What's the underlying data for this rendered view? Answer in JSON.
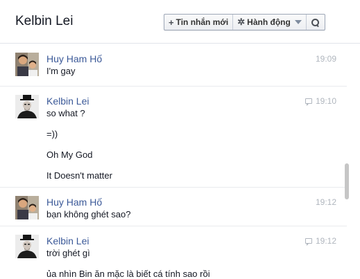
{
  "header": {
    "title": "Kelbin Lei",
    "new_message_label": "Tin nhắn mới",
    "actions_label": "Hành động"
  },
  "icons": {
    "new_message": "plus-icon",
    "actions": "gear-icon",
    "actions_dropdown": "caret-down-icon",
    "search": "search-icon",
    "seen": "speech-bubble-icon"
  },
  "colors": {
    "sender_name": "#3b5998",
    "timestamp": "#b0b6be"
  },
  "messages": [
    {
      "sender": "Huy Ham Hố",
      "time": "19:09",
      "seen": false,
      "lines": [
        "I'm gay"
      ]
    },
    {
      "sender": "Kelbin Lei",
      "time": "19:10",
      "seen": true,
      "lines": [
        "so what ?",
        "=))",
        "Oh My God",
        "It Doesn't matter"
      ]
    },
    {
      "sender": "Huy Ham Hố",
      "time": "19:12",
      "seen": false,
      "lines": [
        "bạn không ghét sao?"
      ]
    },
    {
      "sender": "Kelbin Lei",
      "time": "19:12",
      "seen": true,
      "lines": [
        "trời ghét gì",
        "ủa nhìn Bin ăn mặc là biết cá tính sao rồi"
      ]
    }
  ]
}
